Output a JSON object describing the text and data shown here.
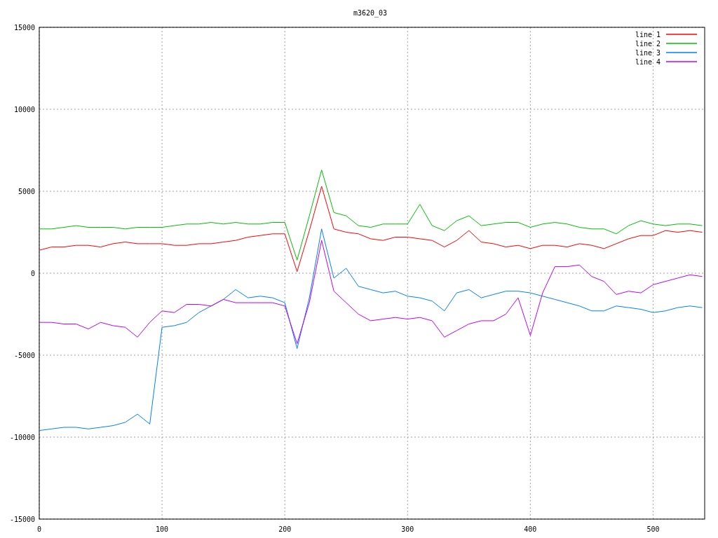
{
  "chart_data": {
    "type": "line",
    "title": "m3620_03",
    "x": [
      0,
      10,
      20,
      30,
      40,
      50,
      60,
      70,
      80,
      90,
      100,
      110,
      120,
      130,
      140,
      150,
      160,
      170,
      180,
      190,
      200,
      210,
      220,
      230,
      240,
      250,
      260,
      270,
      280,
      290,
      300,
      310,
      320,
      330,
      340,
      350,
      360,
      370,
      380,
      390,
      400,
      410,
      420,
      430,
      440,
      450,
      460,
      470,
      480,
      490,
      500,
      510,
      520,
      530,
      540
    ],
    "series": [
      {
        "name": "line 1",
        "color": "#ff0000",
        "values": [
          1400,
          1600,
          1600,
          1700,
          1700,
          1600,
          1800,
          1900,
          1800,
          1800,
          1800,
          1700,
          1700,
          1800,
          1800,
          1900,
          2000,
          2200,
          2300,
          2400,
          2400,
          100,
          2600,
          5300,
          2700,
          2500,
          2400,
          2100,
          2000,
          2200,
          2200,
          2100,
          2000,
          1600,
          2000,
          2600,
          1900,
          1800,
          1600,
          1700,
          1500,
          1700,
          1700,
          1600,
          1800,
          1700,
          1500,
          1800,
          2100,
          2300,
          2300,
          2600,
          2500,
          2600,
          2500
        ]
      },
      {
        "name": "line 2",
        "color": "#00c000",
        "values": [
          2700,
          2700,
          2800,
          2900,
          2800,
          2800,
          2800,
          2700,
          2800,
          2800,
          2800,
          2900,
          3000,
          3000,
          3100,
          3000,
          3100,
          3000,
          3000,
          3100,
          3100,
          800,
          3500,
          6300,
          3700,
          3500,
          2900,
          2800,
          3000,
          3000,
          3000,
          4200,
          2900,
          2600,
          3200,
          3500,
          2900,
          3000,
          3100,
          3100,
          2800,
          3000,
          3100,
          3000,
          2800,
          2700,
          2700,
          2400,
          2900,
          3200,
          3000,
          2900,
          3000,
          3000,
          2900
        ]
      },
      {
        "name": "line 3",
        "color": "#0080ff",
        "values": [
          -9600,
          -9500,
          -9400,
          -9400,
          -9500,
          -9400,
          -9300,
          -9100,
          -8600,
          -9200,
          -3300,
          -3200,
          -3000,
          -2400,
          -2000,
          -1600,
          -1000,
          -1500,
          -1400,
          -1500,
          -1800,
          -4600,
          -1500,
          2700,
          -300,
          300,
          -800,
          -1000,
          -1200,
          -1100,
          -1400,
          -1500,
          -1700,
          -2300,
          -1200,
          -1000,
          -1500,
          -1300,
          -1100,
          -1100,
          -1200,
          -1400,
          -1600,
          -1800,
          -2000,
          -2300,
          -2300,
          -2000,
          -2100,
          -2200,
          -2400,
          -2300,
          -2100,
          -2000,
          -2100
        ]
      },
      {
        "name": "line 4",
        "color": "#c000ff",
        "values": [
          -3000,
          -3000,
          -3100,
          -3100,
          -3400,
          -3000,
          -3200,
          -3300,
          -3900,
          -3000,
          -2300,
          -2400,
          -1900,
          -1900,
          -2000,
          -1600,
          -1800,
          -1800,
          -1800,
          -1800,
          -2000,
          -4300,
          -1800,
          2000,
          -1100,
          -1800,
          -2500,
          -2900,
          -2800,
          -2700,
          -2800,
          -2700,
          -2900,
          -3900,
          -3500,
          -3100,
          -2900,
          -2900,
          -2500,
          -1500,
          -3800,
          -1200,
          400,
          400,
          500,
          -200,
          -500,
          -1300,
          -1100,
          -1200,
          -700,
          -500,
          -300,
          -100,
          -200
        ]
      }
    ],
    "grid": true,
    "legend": true,
    "xlim": [
      0,
      542
    ],
    "ylim": [
      -15000,
      15000
    ],
    "xticks": [
      0,
      100,
      200,
      300,
      400,
      500
    ],
    "yticks": [
      -15000,
      -10000,
      -5000,
      0,
      5000,
      10000,
      15000
    ]
  }
}
